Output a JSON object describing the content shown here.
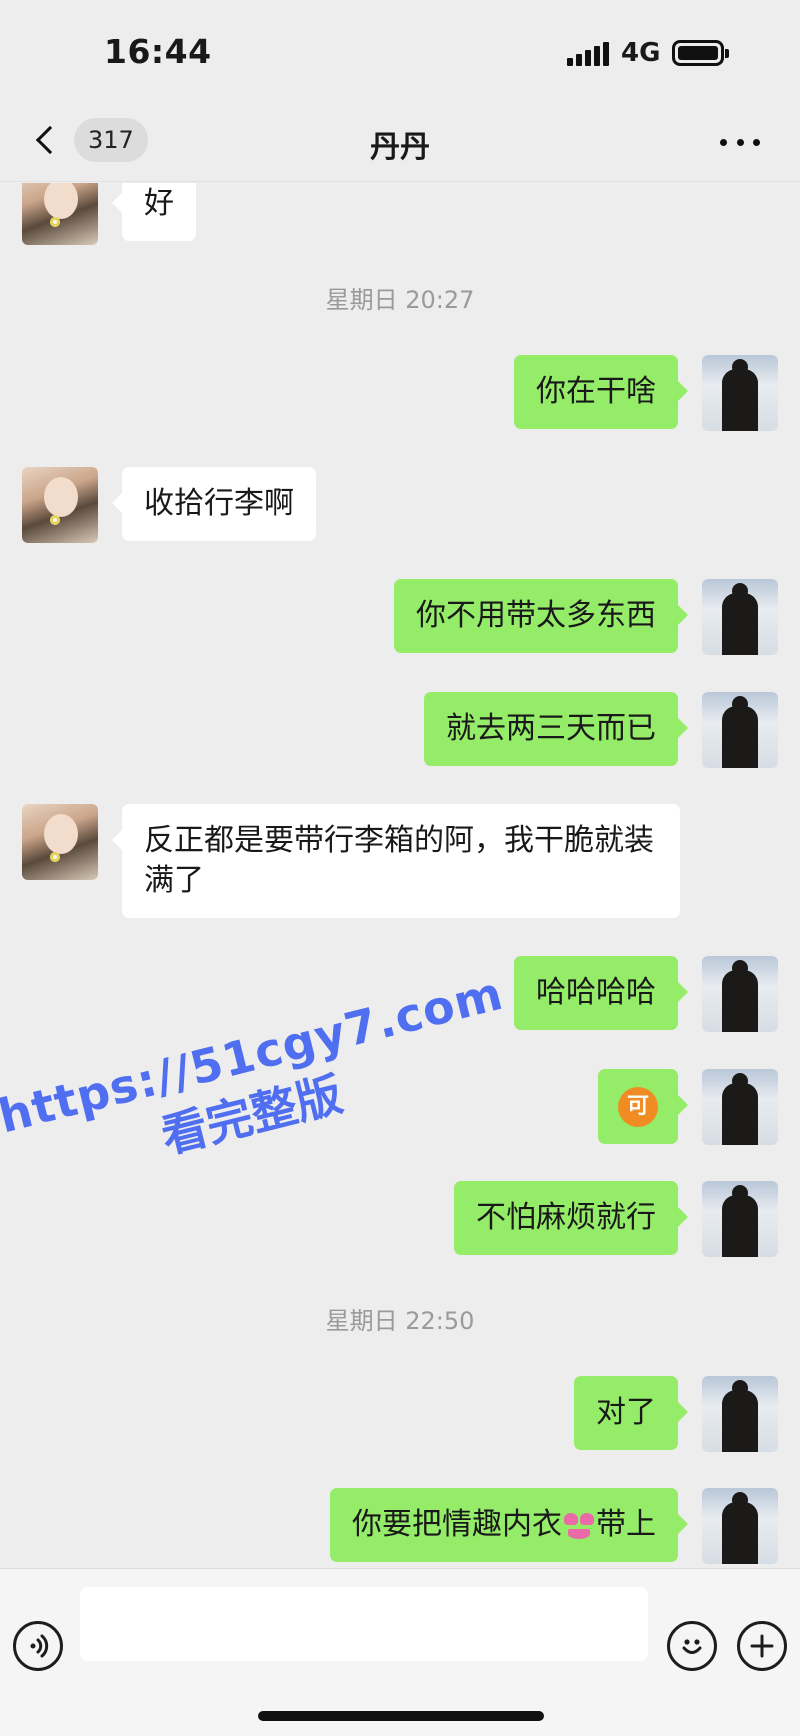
{
  "status_bar": {
    "time": "16:44",
    "network": "4G"
  },
  "nav": {
    "unread_count": "317",
    "title": "丹丹"
  },
  "messages": [
    {
      "from": "friend",
      "text": "好"
    },
    {
      "type": "time",
      "text": "星期日 20:27"
    },
    {
      "from": "self",
      "text": "你在干啥"
    },
    {
      "from": "friend",
      "text": "收拾行李啊"
    },
    {
      "from": "self",
      "text": "你不用带太多东西"
    },
    {
      "from": "self",
      "text": "就去两三天而已"
    },
    {
      "from": "friend",
      "text": "反正都是要带行李箱的阿，我干脆就装满了"
    },
    {
      "from": "self",
      "text": "哈哈哈哈"
    },
    {
      "from": "self",
      "emoji": "可",
      "icon": "ke-emoji-icon"
    },
    {
      "from": "self",
      "text": "不怕麻烦就行"
    },
    {
      "type": "time",
      "text": "星期日 22:50"
    },
    {
      "from": "self",
      "text": "对了"
    },
    {
      "from": "self",
      "text_before": "你要把情趣内衣",
      "icon": "bikini-emoji-icon",
      "text_after": "带上"
    }
  ],
  "watermark": {
    "line1": "https://51cgy7.com",
    "line2": "看完整版"
  },
  "colors": {
    "background": "#ededed",
    "self_bubble": "#95ec69",
    "friend_bubble": "#ffffff",
    "watermark": "#4f6ef0"
  }
}
